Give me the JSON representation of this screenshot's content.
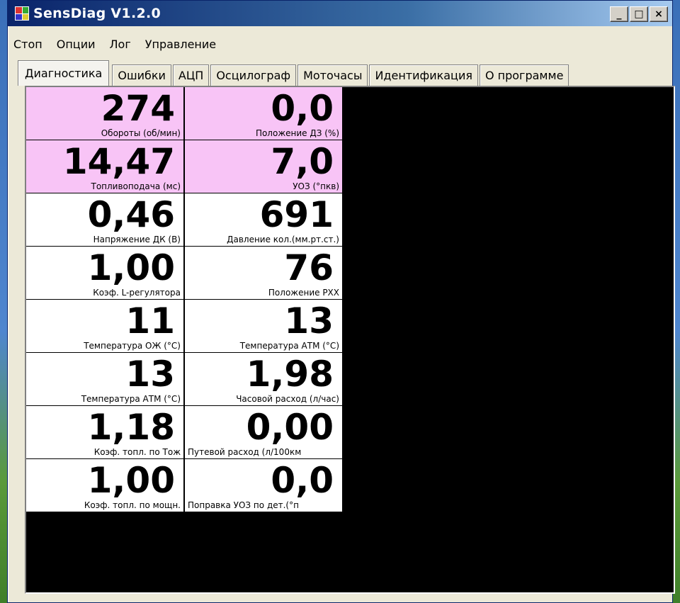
{
  "window": {
    "title": "SensDiag V1.2.0",
    "min_label": "_",
    "max_label": "□",
    "close_label": "×"
  },
  "menu": {
    "items": [
      "Стоп",
      "Опции",
      "Лог",
      "Управление"
    ]
  },
  "tabs": [
    "Диагностика",
    "Ошибки",
    "АЦП",
    "Осцилограф",
    "Моточасы",
    "Идентификация",
    "О программе"
  ],
  "active_tab": "Диагностика",
  "colors": {
    "highlight": "#f8c4f6",
    "normal": "#ffffff",
    "background": "#000000"
  },
  "params": [
    {
      "value": "274",
      "label": "Обороты (об/мин)",
      "highlight": true
    },
    {
      "value": "0,0",
      "label": "Положение ДЗ (%)",
      "highlight": true
    },
    {
      "value": "14,47",
      "label": "Топливоподача (мс)",
      "highlight": true
    },
    {
      "value": "7,0",
      "label": "УОЗ (°пкв)",
      "highlight": true
    },
    {
      "value": "0,46",
      "label": "Напряжение ДК (В)",
      "highlight": false
    },
    {
      "value": "691",
      "label": "Давление кол.(мм.рт.ст.)",
      "highlight": false
    },
    {
      "value": "1,00",
      "label": "Коэф. L-регулятора",
      "highlight": false
    },
    {
      "value": "76",
      "label": "Положение РХХ",
      "highlight": false
    },
    {
      "value": "11",
      "label": "Температура ОЖ (°C)",
      "highlight": false
    },
    {
      "value": "13",
      "label": "Температура АТМ (°C)",
      "highlight": false
    },
    {
      "value": "13",
      "label": "Температура АТМ (°C)",
      "highlight": false
    },
    {
      "value": "1,98",
      "label": "Часовой расход (л/час)",
      "highlight": false
    },
    {
      "value": "1,18",
      "label": "Коэф. топл. по Тож",
      "highlight": false
    },
    {
      "value": "0,00",
      "label": "Путевой расход (л/100км",
      "highlight": false
    },
    {
      "value": "1,00",
      "label": "Коэф. топл. по мощн.",
      "highlight": false
    },
    {
      "value": "0,0",
      "label": "Поправка УОЗ по дет.(°п",
      "highlight": false
    }
  ]
}
